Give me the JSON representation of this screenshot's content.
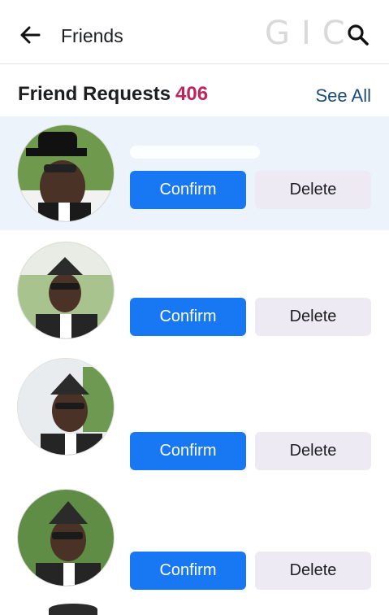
{
  "header": {
    "title": "Friends",
    "watermark": "GIC"
  },
  "section": {
    "title": "Friend Requests",
    "count": "406",
    "see_all": "See All"
  },
  "requests": [
    {
      "confirm_label": "Confirm",
      "delete_label": "Delete"
    },
    {
      "confirm_label": "Confirm",
      "delete_label": "Delete"
    },
    {
      "confirm_label": "Confirm",
      "delete_label": "Delete"
    },
    {
      "confirm_label": "Confirm",
      "delete_label": "Delete"
    }
  ],
  "colors": {
    "confirm_bg": "#1877f2",
    "delete_bg": "#eeeaf3",
    "count_color": "#c0245c",
    "link_color": "#1b4b75",
    "highlight_row": "#edf3fb"
  },
  "icons": [
    "back-arrow-icon",
    "search-icon"
  ]
}
